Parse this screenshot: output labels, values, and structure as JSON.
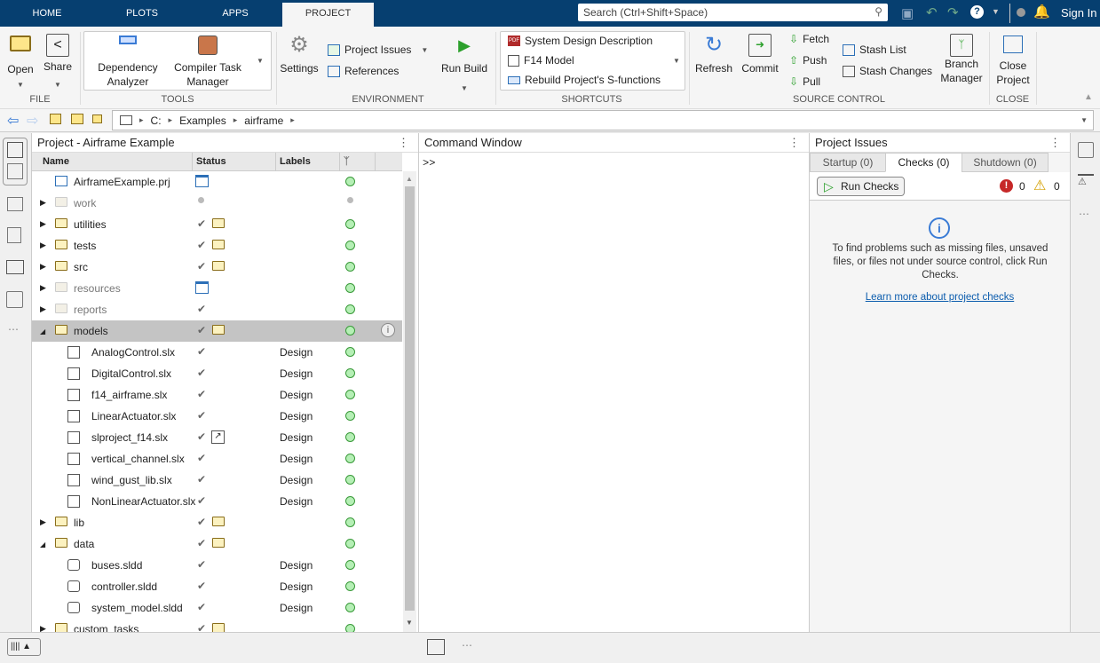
{
  "tabs": [
    "HOME",
    "PLOTS",
    "APPS",
    "PROJECT"
  ],
  "search_placeholder": "Search (Ctrl+Shift+Space)",
  "sign_in": "Sign In",
  "toolstrip": {
    "file": {
      "label": "FILE",
      "open": "Open",
      "share": "Share"
    },
    "tools": {
      "label": "TOOLS",
      "dep1": "Dependency",
      "dep2": "Analyzer",
      "comp1": "Compiler Task",
      "comp2": "Manager"
    },
    "environment": {
      "label": "ENVIRONMENT",
      "settings": "Settings",
      "issues": "Project Issues",
      "references": "References",
      "run_build": "Run Build"
    },
    "shortcuts": {
      "label": "SHORTCUTS",
      "items": [
        "System Design Description",
        "F14 Model",
        "Rebuild Project's S-functions"
      ]
    },
    "source_control": {
      "label": "SOURCE CONTROL",
      "refresh": "Refresh",
      "commit": "Commit",
      "fetch": "Fetch",
      "push": "Push",
      "pull": "Pull",
      "stash_list": "Stash List",
      "stash_changes": "Stash Changes",
      "branch1": "Branch",
      "branch2": "Manager"
    },
    "close": {
      "label": "CLOSE",
      "close1": "Close",
      "close2": "Project"
    }
  },
  "path": [
    "C:",
    "Examples",
    "airframe"
  ],
  "project_panel": {
    "title": "Project - Airframe Example",
    "columns": [
      "Name",
      "Status",
      "Labels"
    ],
    "rows": [
      {
        "name": "AirframeExample.prj",
        "indent": 0,
        "kind": "prj",
        "status": "project",
        "label": "",
        "git": "green"
      },
      {
        "name": "work",
        "indent": 0,
        "kind": "folder-dim",
        "expand": "closed",
        "status": "dot",
        "label": "",
        "git": "grey"
      },
      {
        "name": "utilities",
        "indent": 0,
        "kind": "folder",
        "expand": "closed",
        "status": "check-folder",
        "label": "",
        "git": "green"
      },
      {
        "name": "tests",
        "indent": 0,
        "kind": "folder",
        "expand": "closed",
        "status": "check-folder",
        "label": "",
        "git": "green"
      },
      {
        "name": "src",
        "indent": 0,
        "kind": "folder",
        "expand": "closed",
        "status": "check-folder",
        "label": "",
        "git": "green"
      },
      {
        "name": "resources",
        "indent": 0,
        "kind": "folder-dim",
        "expand": "closed",
        "status": "project",
        "label": "",
        "git": "green"
      },
      {
        "name": "reports",
        "indent": 0,
        "kind": "folder-dim",
        "expand": "closed",
        "status": "check",
        "label": "",
        "git": "green"
      },
      {
        "name": "models",
        "indent": 0,
        "kind": "folder",
        "expand": "open",
        "status": "check-folder",
        "label": "",
        "git": "green",
        "selected": true
      },
      {
        "name": "AnalogControl.slx",
        "indent": 1,
        "kind": "model",
        "status": "check",
        "label": "Design",
        "git": "green"
      },
      {
        "name": "DigitalControl.slx",
        "indent": 1,
        "kind": "model",
        "status": "check",
        "label": "Design",
        "git": "green"
      },
      {
        "name": "f14_airframe.slx",
        "indent": 1,
        "kind": "model",
        "status": "check",
        "label": "Design",
        "git": "green"
      },
      {
        "name": "LinearActuator.slx",
        "indent": 1,
        "kind": "model",
        "status": "check",
        "label": "Design",
        "git": "green"
      },
      {
        "name": "slproject_f14.slx",
        "indent": 1,
        "kind": "model",
        "status": "check-shortcut",
        "label": "Design",
        "git": "green"
      },
      {
        "name": "vertical_channel.slx",
        "indent": 1,
        "kind": "model",
        "status": "check",
        "label": "Design",
        "git": "green"
      },
      {
        "name": "wind_gust_lib.slx",
        "indent": 1,
        "kind": "model",
        "status": "check",
        "label": "Design",
        "git": "green"
      },
      {
        "name": "NonLinearActuator.slx",
        "indent": 1,
        "kind": "model",
        "status": "check",
        "label": "Design",
        "git": "green"
      },
      {
        "name": "lib",
        "indent": 0,
        "kind": "folder",
        "expand": "closed",
        "status": "check-folder",
        "label": "",
        "git": "green"
      },
      {
        "name": "data",
        "indent": 0,
        "kind": "folder",
        "expand": "open",
        "status": "check-folder",
        "label": "",
        "git": "green"
      },
      {
        "name": "buses.sldd",
        "indent": 1,
        "kind": "dict",
        "status": "check",
        "label": "Design",
        "git": "green"
      },
      {
        "name": "controller.sldd",
        "indent": 1,
        "kind": "dict",
        "status": "check",
        "label": "Design",
        "git": "green"
      },
      {
        "name": "system_model.sldd",
        "indent": 1,
        "kind": "dict",
        "status": "check",
        "label": "Design",
        "git": "green"
      },
      {
        "name": "custom_tasks",
        "indent": 0,
        "kind": "folder",
        "expand": "closed",
        "status": "check-folder",
        "label": "",
        "git": "green"
      }
    ]
  },
  "command_window": {
    "title": "Command Window",
    "prompt": ">>"
  },
  "issues": {
    "title": "Project Issues",
    "tabs": [
      "Startup (0)",
      "Checks (0)",
      "Shutdown (0)"
    ],
    "run_checks": "Run Checks",
    "errors": "0",
    "warnings": "0",
    "message": "To find problems such as missing files, unsaved files, or files not under source control, click Run Checks.",
    "link": "Learn more about project checks"
  },
  "colors": {
    "topbar": "#063f70",
    "selected_row": "#c4c4c4",
    "link": "#0b5cad"
  }
}
